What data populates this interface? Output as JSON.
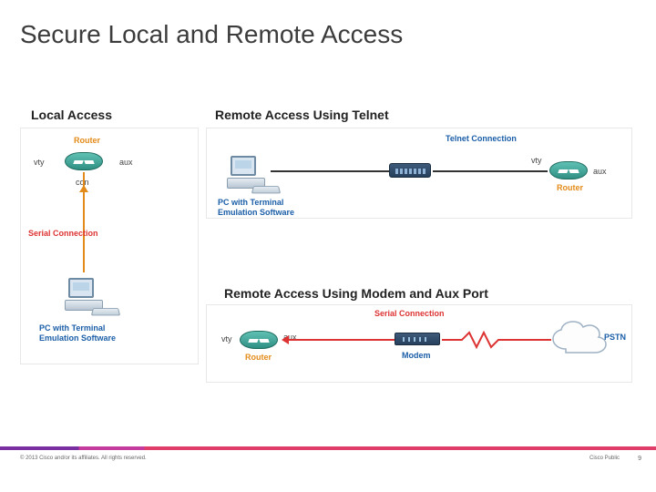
{
  "title": "Secure Local and Remote Access",
  "sections": {
    "local": "Local Access",
    "telnet": "Remote Access Using Telnet",
    "modem": "Remote Access Using Modem and Aux Port"
  },
  "labels": {
    "router": "Router",
    "vty": "vty",
    "aux": "aux",
    "con": "con",
    "serial": "Serial Connection",
    "pc_terminal": "PC with Terminal\nEmulation Software",
    "telnet_conn": "Telnet Connection",
    "modem": "Modem",
    "pstn": "PSTN"
  },
  "footer": {
    "copyright": "© 2013 Cisco and/or its affiliates. All rights reserved.",
    "cisco_public": "Cisco Public",
    "page": "9"
  }
}
